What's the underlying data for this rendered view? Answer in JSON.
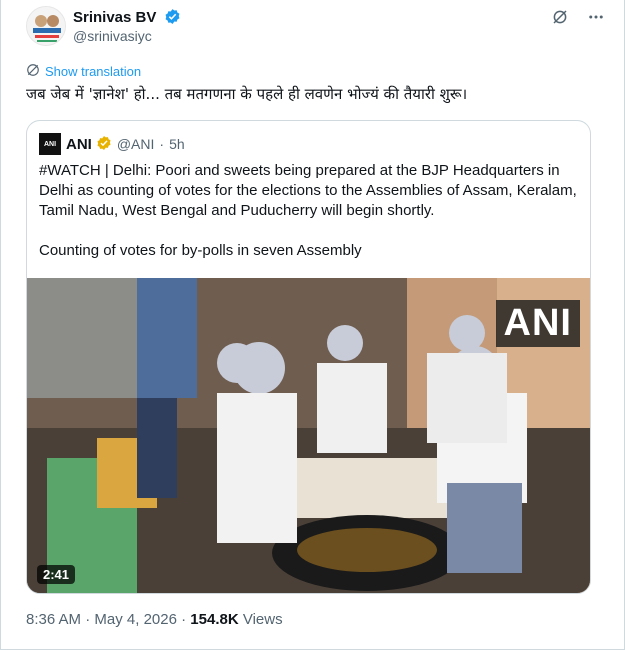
{
  "author": {
    "name": "Srinivas BV",
    "handle": "@srinivasiyc",
    "verified_color": "#1d9bf0"
  },
  "actions": {
    "grok_icon": "grok-icon",
    "more_icon": "more-icon"
  },
  "show_translation": "Show translation",
  "tweet_text": "जब जेब में 'ज्ञानेश' हो... तब मतगणना के पहले ही लवणेन भोज्यं की तैयारी शुरू।",
  "quoted": {
    "logo_text": "ANI",
    "name": "ANI",
    "handle": "@ANI",
    "separator": "·",
    "time": "5h",
    "verified_color": "#e8b200",
    "paragraph1": "#WATCH | Delhi: Poori and sweets being prepared at the BJP Headquarters in Delhi as counting of votes for the elections to the Assemblies of Assam, Keralam, Tamil Nadu, West Bengal and Puducherry will begin shortly.",
    "paragraph2": "Counting of votes for by-polls in seven Assembly",
    "video": {
      "watermark": "ANI",
      "duration": "2:41"
    }
  },
  "footer": {
    "time": "8:36 AM",
    "dot": "·",
    "date": "May 4, 2026",
    "views_count": "154.8K",
    "views_label": "Views"
  }
}
